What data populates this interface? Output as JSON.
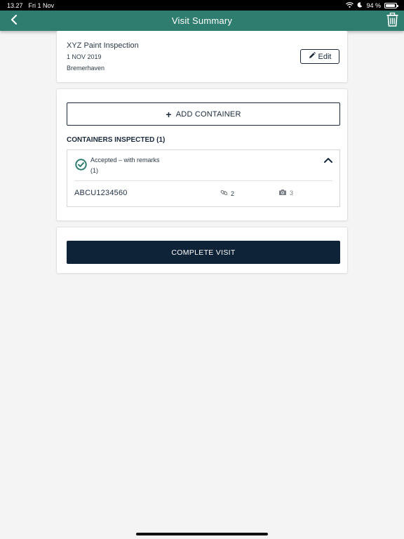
{
  "status_bar": {
    "time": "13.27",
    "date": "Fri 1 Nov",
    "battery": "94 %",
    "battery_level": 0.94,
    "icons": [
      "wifi-icon",
      "moon-icon",
      "battery-icon"
    ]
  },
  "nav": {
    "title": "Visit Summary",
    "back_icon": "chevron-left-icon",
    "trash_icon": "trash-icon",
    "color": "#2f7d6e"
  },
  "visit": {
    "name": "XYZ Paint Inspection",
    "date": "1 NOV 2019",
    "location": "Bremerhaven",
    "edit_label": "Edit",
    "edit_icon": "pencil-icon"
  },
  "containers": {
    "add_label": "ADD CONTAINER",
    "section_title": "CONTAINERS INSPECTED (1)",
    "group": {
      "status_label": "Accepted – with remarks",
      "status_count": "(1)",
      "status_icon": "check-circle-icon",
      "status_color": "#2f7d6e",
      "items": [
        {
          "id": "ABCU1234560",
          "links": "2",
          "photos": "3"
        }
      ]
    }
  },
  "actions": {
    "complete_label": "COMPLETE VISIT",
    "complete_color": "#0f2338"
  }
}
